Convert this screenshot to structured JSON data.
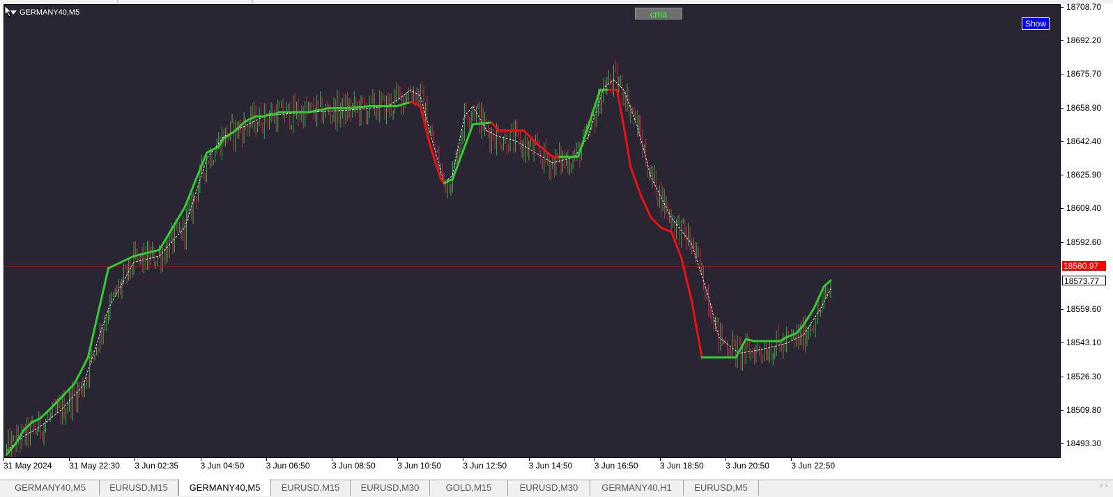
{
  "chart": {
    "symbol_label": "GERMANY40,M5",
    "cma_label": "cma",
    "show_label": "Show",
    "price_labels": [
      "18708.70",
      "18692.20",
      "18675.70",
      "18658.90",
      "18642.40",
      "18625.90",
      "18609.40",
      "18592.60",
      "18559.60",
      "18543.10",
      "18526.30",
      "18509.80",
      "18493.30"
    ],
    "current_price": "18580.97",
    "secondary_price": "18573.77",
    "time_labels": [
      "31 May 2024",
      "31 May 22:30",
      "3 Jun 02:35",
      "3 Jun 04:50",
      "3 Jun 06:50",
      "3 Jun 08:50",
      "3 Jun 10:50",
      "3 Jun 12:50",
      "3 Jun 14:50",
      "3 Jun 16:50",
      "3 Jun 18:50",
      "3 Jun 20:50",
      "3 Jun 22:50"
    ],
    "colors": {
      "background": "#2a2532",
      "bull": "#3cb043",
      "bear": "#c0304a",
      "cma_up": "#33cc33",
      "cma_down": "#ee1111",
      "price_line": "#cc0000",
      "dashed": "#e0e0e0"
    }
  },
  "chart_data": {
    "type": "candlestick",
    "ylim": [
      18486,
      18710
    ],
    "cma_line": {
      "x_index": [
        0,
        5,
        10,
        15,
        20,
        25,
        32,
        40,
        48,
        60,
        75,
        90,
        105,
        118,
        125,
        128,
        135,
        140,
        142,
        147,
        152,
        155,
        158,
        161,
        162,
        165,
        170,
        178,
        190,
        200,
        215,
        230,
        238,
        239,
        244,
        250,
        256,
        258,
        263,
        275,
        286,
        290,
        300,
        305,
        312,
        322,
        326,
        329,
        333,
        337,
        343,
        350,
        355,
        360,
        364,
        368,
        374,
        380,
        386,
        392,
        398,
        404,
        407,
        410,
        420,
        428,
        430,
        436,
        441,
        446,
        451,
        456,
        460,
        466,
        470,
        476,
        482,
        486
      ],
      "values": [
        18488,
        18493,
        18500,
        18504,
        18506,
        18510,
        18516,
        18523,
        18536,
        18580,
        18586,
        18589,
        18610,
        18637,
        18640,
        18644,
        18648,
        18652,
        18653,
        18655,
        18655,
        18656,
        18656,
        18657,
        18657,
        18657,
        18657,
        18657,
        18659,
        18659,
        18660,
        18660,
        18662,
        18662,
        18660,
        18640,
        18624,
        18622,
        18624,
        18651,
        18652,
        18648,
        18648,
        18648,
        18642,
        18635,
        18635,
        18635,
        18635,
        18635,
        18650,
        18668,
        18668,
        18668,
        18650,
        18630,
        18616,
        18605,
        18600,
        18598,
        18585,
        18564,
        18550,
        18536,
        18536,
        18536,
        18536,
        18545,
        18544,
        18544,
        18544,
        18544,
        18546,
        18548,
        18552,
        18560,
        18571,
        18574
      ],
      "trend": [
        "up",
        "up",
        "up",
        "up",
        "up",
        "up",
        "up",
        "up",
        "up",
        "up",
        "up",
        "up",
        "up",
        "up",
        "up",
        "up",
        "up",
        "up",
        "up",
        "up",
        "up",
        "up",
        "up",
        "up",
        "up",
        "up",
        "up",
        "up",
        "up",
        "up",
        "up",
        "up",
        "up",
        "down",
        "down",
        "down",
        "down",
        "down",
        "up",
        "up",
        "up",
        "down",
        "down",
        "down",
        "down",
        "down",
        "down",
        "up",
        "up",
        "up",
        "up",
        "up",
        "up",
        "down",
        "down",
        "down",
        "down",
        "down",
        "down",
        "down",
        "down",
        "down",
        "down",
        "down",
        "up",
        "up",
        "up",
        "up",
        "up",
        "up",
        "up",
        "up",
        "up",
        "up",
        "up",
        "up",
        "up",
        "up"
      ]
    },
    "dashed_ma": {
      "x_index": [
        0,
        10,
        20,
        32,
        45,
        60,
        75,
        90,
        105,
        118,
        128,
        140,
        152,
        162,
        178,
        200,
        215,
        225,
        232,
        238,
        244,
        252,
        258,
        263,
        270,
        275,
        283,
        290,
        300,
        312,
        322,
        335,
        343,
        352,
        358,
        364,
        372,
        380,
        392,
        404,
        414,
        420,
        432,
        446,
        460,
        470,
        480,
        486
      ],
      "values": [
        18490,
        18497,
        18502,
        18510,
        18522,
        18560,
        18583,
        18586,
        18600,
        18634,
        18645,
        18650,
        18655,
        18656,
        18657,
        18658,
        18659,
        18660,
        18664,
        18668,
        18665,
        18640,
        18622,
        18626,
        18655,
        18660,
        18648,
        18645,
        18643,
        18637,
        18632,
        18635,
        18645,
        18669,
        18673,
        18668,
        18650,
        18625,
        18605,
        18592,
        18566,
        18546,
        18538,
        18540,
        18543,
        18547,
        18560,
        18570
      ]
    },
    "current_price": 18580.97,
    "secondary_price": 18573.77,
    "candle_count": 487
  },
  "tabs": [
    {
      "label": "GERMANY40,M5",
      "active": false
    },
    {
      "label": "EURUSD,M15",
      "active": false
    },
    {
      "label": "GERMANY40,M5",
      "active": true
    },
    {
      "label": "EURUSD,M15",
      "active": false
    },
    {
      "label": "EURUSD,M30",
      "active": false
    },
    {
      "label": "GOLD,M15",
      "active": false
    },
    {
      "label": "EURUSD,M30",
      "active": false
    },
    {
      "label": "GERMANY40,H1",
      "active": false
    },
    {
      "label": "EURUSD,M5",
      "active": false
    }
  ],
  "tab_scroll": "‹ ›"
}
